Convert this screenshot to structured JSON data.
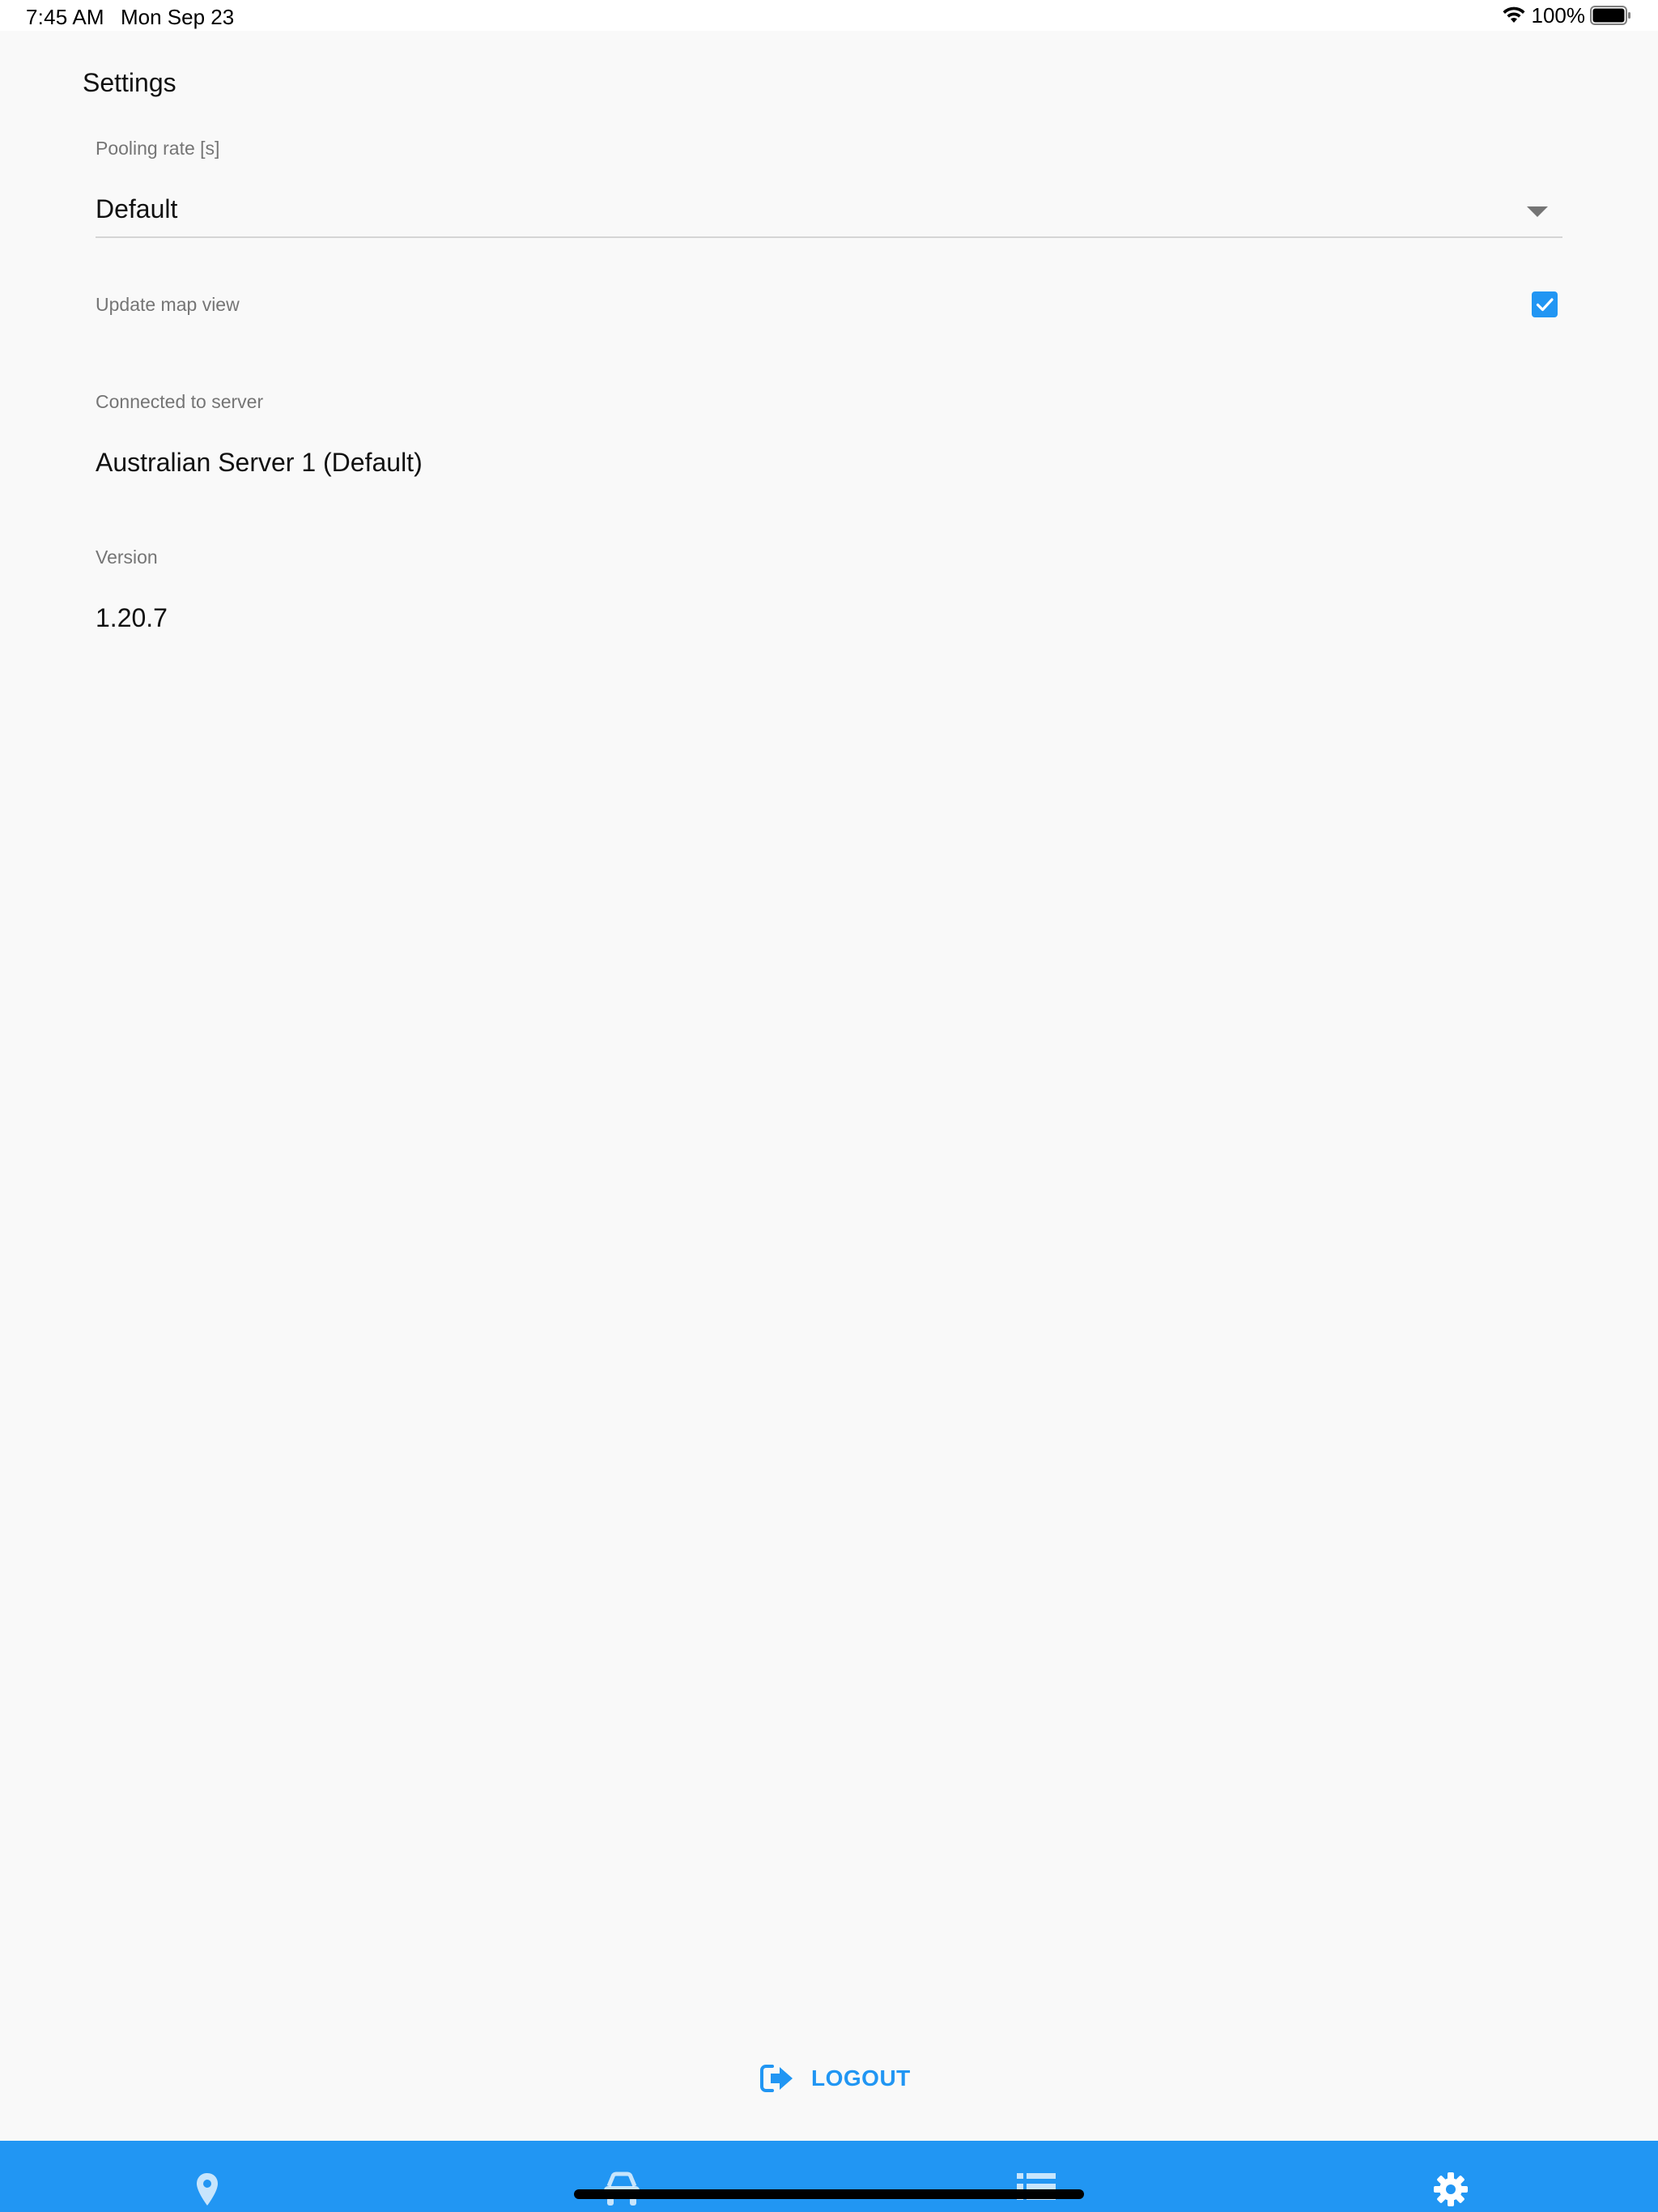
{
  "status_bar": {
    "time": "7:45 AM",
    "date": "Mon Sep 23",
    "battery": "100%",
    "icons": [
      "wifi-icon",
      "battery-icon"
    ]
  },
  "settings": {
    "title": "Settings",
    "pooling_rate": {
      "label": "Pooling rate [s]",
      "value": "Default"
    },
    "update_map_view": {
      "label": "Update map view",
      "checked": true
    },
    "server": {
      "label": "Connected to server",
      "value": "Australian Server 1 (Default)"
    },
    "version": {
      "label": "Version",
      "value": "1.20.7"
    }
  },
  "logout": {
    "label": "LOGOUT",
    "icon": "logout-icon"
  },
  "tab_bar": {
    "tabs": [
      {
        "icon": "map-pin-icon"
      },
      {
        "icon": "car-icon"
      },
      {
        "icon": "list-icon"
      },
      {
        "icon": "gear-icon"
      }
    ]
  },
  "colors": {
    "accent": "#2196f3",
    "label_gray": "#757575",
    "background": "#f9f9f9"
  }
}
